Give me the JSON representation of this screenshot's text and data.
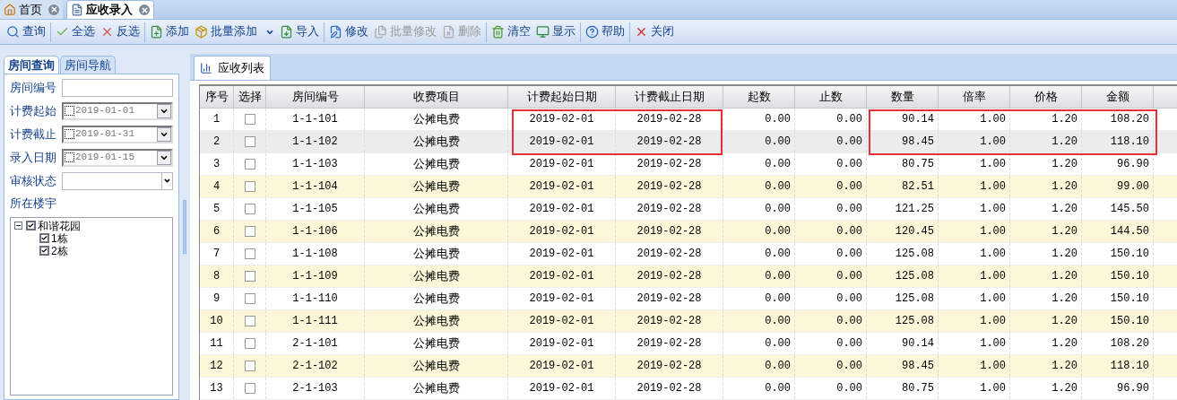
{
  "doc_tabs": [
    {
      "label": "首页",
      "selected": false
    },
    {
      "label": "应收录入",
      "selected": true
    }
  ],
  "toolbar": [
    {
      "label": "查询",
      "disabled": false,
      "separator_before": false,
      "dropdown": false
    },
    {
      "label": "全选",
      "disabled": false,
      "separator_before": true,
      "dropdown": false
    },
    {
      "label": "反选",
      "disabled": false,
      "separator_before": false,
      "dropdown": false
    },
    {
      "label": "添加",
      "disabled": false,
      "separator_before": true,
      "dropdown": false
    },
    {
      "label": "批量添加",
      "disabled": false,
      "separator_before": false,
      "dropdown": true
    },
    {
      "label": "导入",
      "disabled": false,
      "separator_before": false,
      "dropdown": false
    },
    {
      "label": "修改",
      "disabled": false,
      "separator_before": true,
      "dropdown": false
    },
    {
      "label": "批量修改",
      "disabled": true,
      "separator_before": false,
      "dropdown": false
    },
    {
      "label": "删除",
      "disabled": true,
      "separator_before": false,
      "dropdown": false
    },
    {
      "label": "清空",
      "disabled": false,
      "separator_before": true,
      "dropdown": false
    },
    {
      "label": "显示",
      "disabled": false,
      "separator_before": false,
      "dropdown": false
    },
    {
      "label": "帮助",
      "disabled": false,
      "separator_before": true,
      "dropdown": false
    },
    {
      "label": "关闭",
      "disabled": false,
      "separator_before": true,
      "dropdown": false
    }
  ],
  "search_panel": {
    "tabs": [
      {
        "label": "房间查询",
        "selected": true
      },
      {
        "label": "房间导航",
        "selected": false
      }
    ],
    "fields": [
      {
        "kind": "text",
        "label": "房间编号"
      },
      {
        "kind": "date",
        "label": "计费起始",
        "value": "2019-01-01",
        "checked": false
      },
      {
        "kind": "date",
        "label": "计费截止",
        "value": "2019-01-31",
        "checked": false
      },
      {
        "kind": "date",
        "label": "录入日期",
        "value": "2019-01-15",
        "checked": false
      },
      {
        "kind": "combo",
        "label": "审核状态"
      }
    ],
    "building_label": "所在楼宇",
    "tree": [
      {
        "label": "和谐花园",
        "checked": true,
        "expanded": true,
        "children": [
          {
            "label": "1栋",
            "checked": true
          },
          {
            "label": "2栋",
            "checked": true
          }
        ]
      }
    ]
  },
  "list_tab": {
    "label": "应收列表",
    "selected": true
  },
  "table": {
    "columns": [
      "序号",
      "选择",
      "房间编号",
      "收费项目",
      "计费起始日期",
      "计费截止日期",
      "起数",
      "止数",
      "数量",
      "倍率",
      "价格",
      "金额"
    ],
    "rows": [
      {
        "cells": [
          "1",
          "",
          "1-1-101",
          "公摊电费",
          "2019-02-01",
          "2019-02-28",
          "0.00",
          "0.00",
          "90.14",
          "1.00",
          "1.20",
          "108.20"
        ],
        "checked": false,
        "hovered": false
      },
      {
        "cells": [
          "2",
          "",
          "1-1-102",
          "公摊电费",
          "2019-02-01",
          "2019-02-28",
          "0.00",
          "0.00",
          "98.45",
          "1.00",
          "1.20",
          "118.10"
        ],
        "checked": false,
        "hovered": true
      },
      {
        "cells": [
          "3",
          "",
          "1-1-103",
          "公摊电费",
          "2019-02-01",
          "2019-02-28",
          "0.00",
          "0.00",
          "80.75",
          "1.00",
          "1.20",
          "96.90"
        ],
        "checked": false,
        "hovered": false
      },
      {
        "cells": [
          "4",
          "",
          "1-1-104",
          "公摊电费",
          "2019-02-01",
          "2019-02-28",
          "0.00",
          "0.00",
          "82.51",
          "1.00",
          "1.20",
          "99.00"
        ],
        "checked": false,
        "hovered": false
      },
      {
        "cells": [
          "5",
          "",
          "1-1-105",
          "公摊电费",
          "2019-02-01",
          "2019-02-28",
          "0.00",
          "0.00",
          "121.25",
          "1.00",
          "1.20",
          "145.50"
        ],
        "checked": false,
        "hovered": false
      },
      {
        "cells": [
          "6",
          "",
          "1-1-106",
          "公摊电费",
          "2019-02-01",
          "2019-02-28",
          "0.00",
          "0.00",
          "120.45",
          "1.00",
          "1.20",
          "144.50"
        ],
        "checked": false,
        "hovered": false
      },
      {
        "cells": [
          "7",
          "",
          "1-1-108",
          "公摊电费",
          "2019-02-01",
          "2019-02-28",
          "0.00",
          "0.00",
          "125.08",
          "1.00",
          "1.20",
          "150.10"
        ],
        "checked": false,
        "hovered": false
      },
      {
        "cells": [
          "8",
          "",
          "1-1-109",
          "公摊电费",
          "2019-02-01",
          "2019-02-28",
          "0.00",
          "0.00",
          "125.08",
          "1.00",
          "1.20",
          "150.10"
        ],
        "checked": false,
        "hovered": false
      },
      {
        "cells": [
          "9",
          "",
          "1-1-110",
          "公摊电费",
          "2019-02-01",
          "2019-02-28",
          "0.00",
          "0.00",
          "125.08",
          "1.00",
          "1.20",
          "150.10"
        ],
        "checked": false,
        "hovered": false
      },
      {
        "cells": [
          "10",
          "",
          "1-1-111",
          "公摊电费",
          "2019-02-01",
          "2019-02-28",
          "0.00",
          "0.00",
          "125.08",
          "1.00",
          "1.20",
          "150.10"
        ],
        "checked": false,
        "hovered": false
      },
      {
        "cells": [
          "11",
          "",
          "2-1-101",
          "公摊电费",
          "2019-02-01",
          "2019-02-28",
          "0.00",
          "0.00",
          "90.14",
          "1.00",
          "1.20",
          "108.20"
        ],
        "checked": false,
        "hovered": false
      },
      {
        "cells": [
          "12",
          "",
          "2-1-102",
          "公摊电费",
          "2019-02-01",
          "2019-02-28",
          "0.00",
          "0.00",
          "98.45",
          "1.00",
          "1.20",
          "118.10"
        ],
        "checked": false,
        "hovered": false
      },
      {
        "cells": [
          "13",
          "",
          "2-1-103",
          "公摊电费",
          "2019-02-01",
          "2019-02-28",
          "0.00",
          "0.00",
          "80.75",
          "1.00",
          "1.20",
          "96.90"
        ],
        "checked": false,
        "hovered": false
      }
    ]
  }
}
